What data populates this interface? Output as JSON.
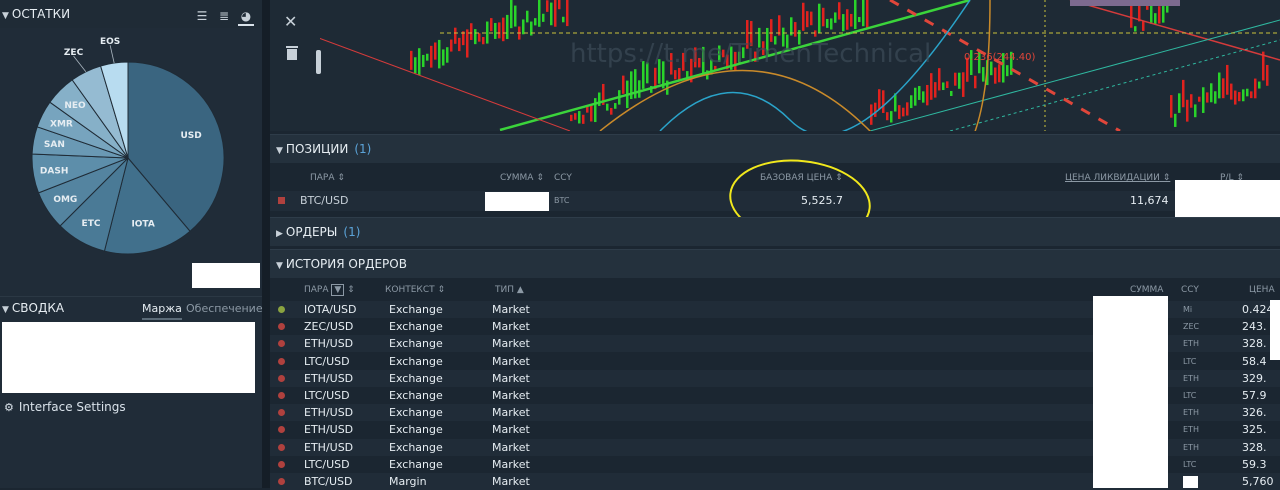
{
  "balances": {
    "title": "ОСТАТКИ",
    "view_icons": [
      "list-icon",
      "list-detail-icon",
      "pie-chart-icon"
    ],
    "slices": [
      {
        "label": "USD",
        "value": 29.5,
        "color": "#3a6580"
      },
      {
        "label": "IOTA",
        "value": 11.5,
        "color": "#41708c"
      },
      {
        "label": "ETC",
        "value": 6.5,
        "color": "#4a7a96"
      },
      {
        "label": "OMG",
        "value": 5.0,
        "color": "#5484a0"
      },
      {
        "label": "DASH",
        "value": 5.0,
        "color": "#5d8eaa"
      },
      {
        "label": "SAN",
        "value": 3.5,
        "color": "#6a99b4"
      },
      {
        "label": "XMR",
        "value": 3.5,
        "color": "#77a4be"
      },
      {
        "label": "NEO",
        "value": 4.0,
        "color": "#86b0c8"
      },
      {
        "label": "ZEC",
        "value": 4.0,
        "color": "#95bbd2"
      },
      {
        "label": "EOS",
        "value": 3.5,
        "color": "#b8dcf0"
      }
    ]
  },
  "summary": {
    "title": "СВОДКА",
    "tab_margin": "Маржа",
    "tab_collateral": "Обеспечение"
  },
  "settings_label": "Interface Settings",
  "positions": {
    "title": "ПОЗИЦИИ",
    "count": "(1)",
    "headers": {
      "pair": "ПАРА",
      "amount": "СУММА",
      "ccy": "CCY",
      "base_price": "БАЗОВАЯ ЦЕНА",
      "liq_price": "ЦЕНА ЛИКВИДАЦИИ",
      "pl": "P/L"
    },
    "rows": [
      {
        "pair": "BTC/USD",
        "ccy": "BTC",
        "base_price": "5,525.7",
        "liq_price": "11,674"
      }
    ]
  },
  "orders": {
    "title": "ОРДЕРЫ",
    "count": "(1)"
  },
  "history": {
    "title": "ИСТОРИЯ ОРДЕРОВ",
    "headers": {
      "pair": "ПАРА",
      "context": "КОНТЕКСТ",
      "type": "ТИП",
      "amount": "СУММА",
      "ccy": "CCY",
      "price": "ЦЕНА"
    },
    "rows": [
      {
        "pair": "IOTA/USD",
        "context": "Exchange",
        "type": "Market",
        "ccy": "Mi",
        "price": "0.424",
        "status": "green"
      },
      {
        "pair": "ZEC/USD",
        "context": "Exchange",
        "type": "Market",
        "ccy": "ZEC",
        "price": "243.",
        "status": "red"
      },
      {
        "pair": "ETH/USD",
        "context": "Exchange",
        "type": "Market",
        "ccy": "ETH",
        "price": "328.",
        "status": "red"
      },
      {
        "pair": "LTC/USD",
        "context": "Exchange",
        "type": "Market",
        "ccy": "LTC",
        "price": "58.4",
        "status": "red"
      },
      {
        "pair": "ETH/USD",
        "context": "Exchange",
        "type": "Market",
        "ccy": "ETH",
        "price": "329.",
        "status": "red"
      },
      {
        "pair": "LTC/USD",
        "context": "Exchange",
        "type": "Market",
        "ccy": "LTC",
        "price": "57.9",
        "status": "red"
      },
      {
        "pair": "ETH/USD",
        "context": "Exchange",
        "type": "Market",
        "ccy": "ETH",
        "price": "326.",
        "status": "red"
      },
      {
        "pair": "ETH/USD",
        "context": "Exchange",
        "type": "Market",
        "ccy": "ETH",
        "price": "325.",
        "status": "red"
      },
      {
        "pair": "ETH/USD",
        "context": "Exchange",
        "type": "Market",
        "ccy": "ETH",
        "price": "328.",
        "status": "red"
      },
      {
        "pair": "LTC/USD",
        "context": "Exchange",
        "type": "Market",
        "ccy": "LTC",
        "price": "59.3",
        "status": "red"
      },
      {
        "pair": "BTC/USD",
        "context": "Margin",
        "type": "Market",
        "ccy": "BTC",
        "price": "5,760",
        "status": "red"
      }
    ]
  },
  "chart": {
    "fib_label": "0.236(244.40)",
    "watermark": "https://t.me/TimenTechnical"
  }
}
